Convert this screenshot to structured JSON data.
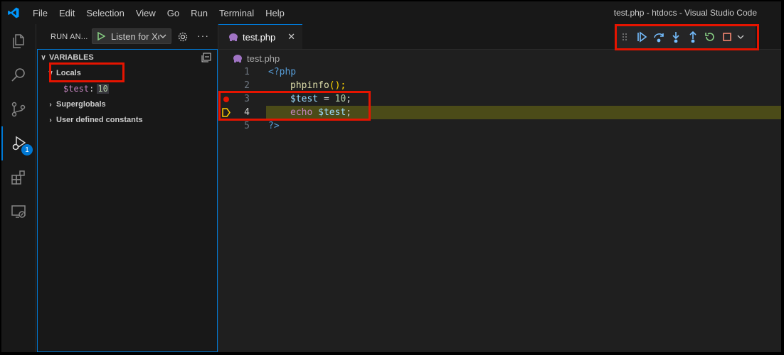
{
  "title_bar": {
    "menu": [
      "File",
      "Edit",
      "Selection",
      "View",
      "Go",
      "Run",
      "Terminal",
      "Help"
    ],
    "window_title": "test.php - htdocs - Visual Studio Code"
  },
  "activity_bar": {
    "debug_badge": "1"
  },
  "sidebar": {
    "run_label": "RUN AN...",
    "launch_config": "Listen for Xdebug",
    "variables_title": "VARIABLES",
    "locals_label": "Locals",
    "local_var": {
      "name": "$test",
      "value": "10"
    },
    "groups": [
      "Superglobals",
      "User defined constants"
    ]
  },
  "editor": {
    "tab_label": "test.php",
    "breadcrumb": "test.php",
    "lines": [
      {
        "num": "1",
        "text": "<?php"
      },
      {
        "num": "2",
        "fn": "phpinfo",
        "paren": "();"
      },
      {
        "num": "3",
        "var": "$test",
        "op": " = ",
        "num_val": "10",
        "end": ";"
      },
      {
        "num": "4",
        "kw": "echo",
        "var": "$test",
        "end": ";"
      },
      {
        "num": "5",
        "text": "?>"
      }
    ]
  },
  "colors": {
    "accent": "#0078d4",
    "highlight_box": "#e51400",
    "current_line": "#4b4b18"
  }
}
